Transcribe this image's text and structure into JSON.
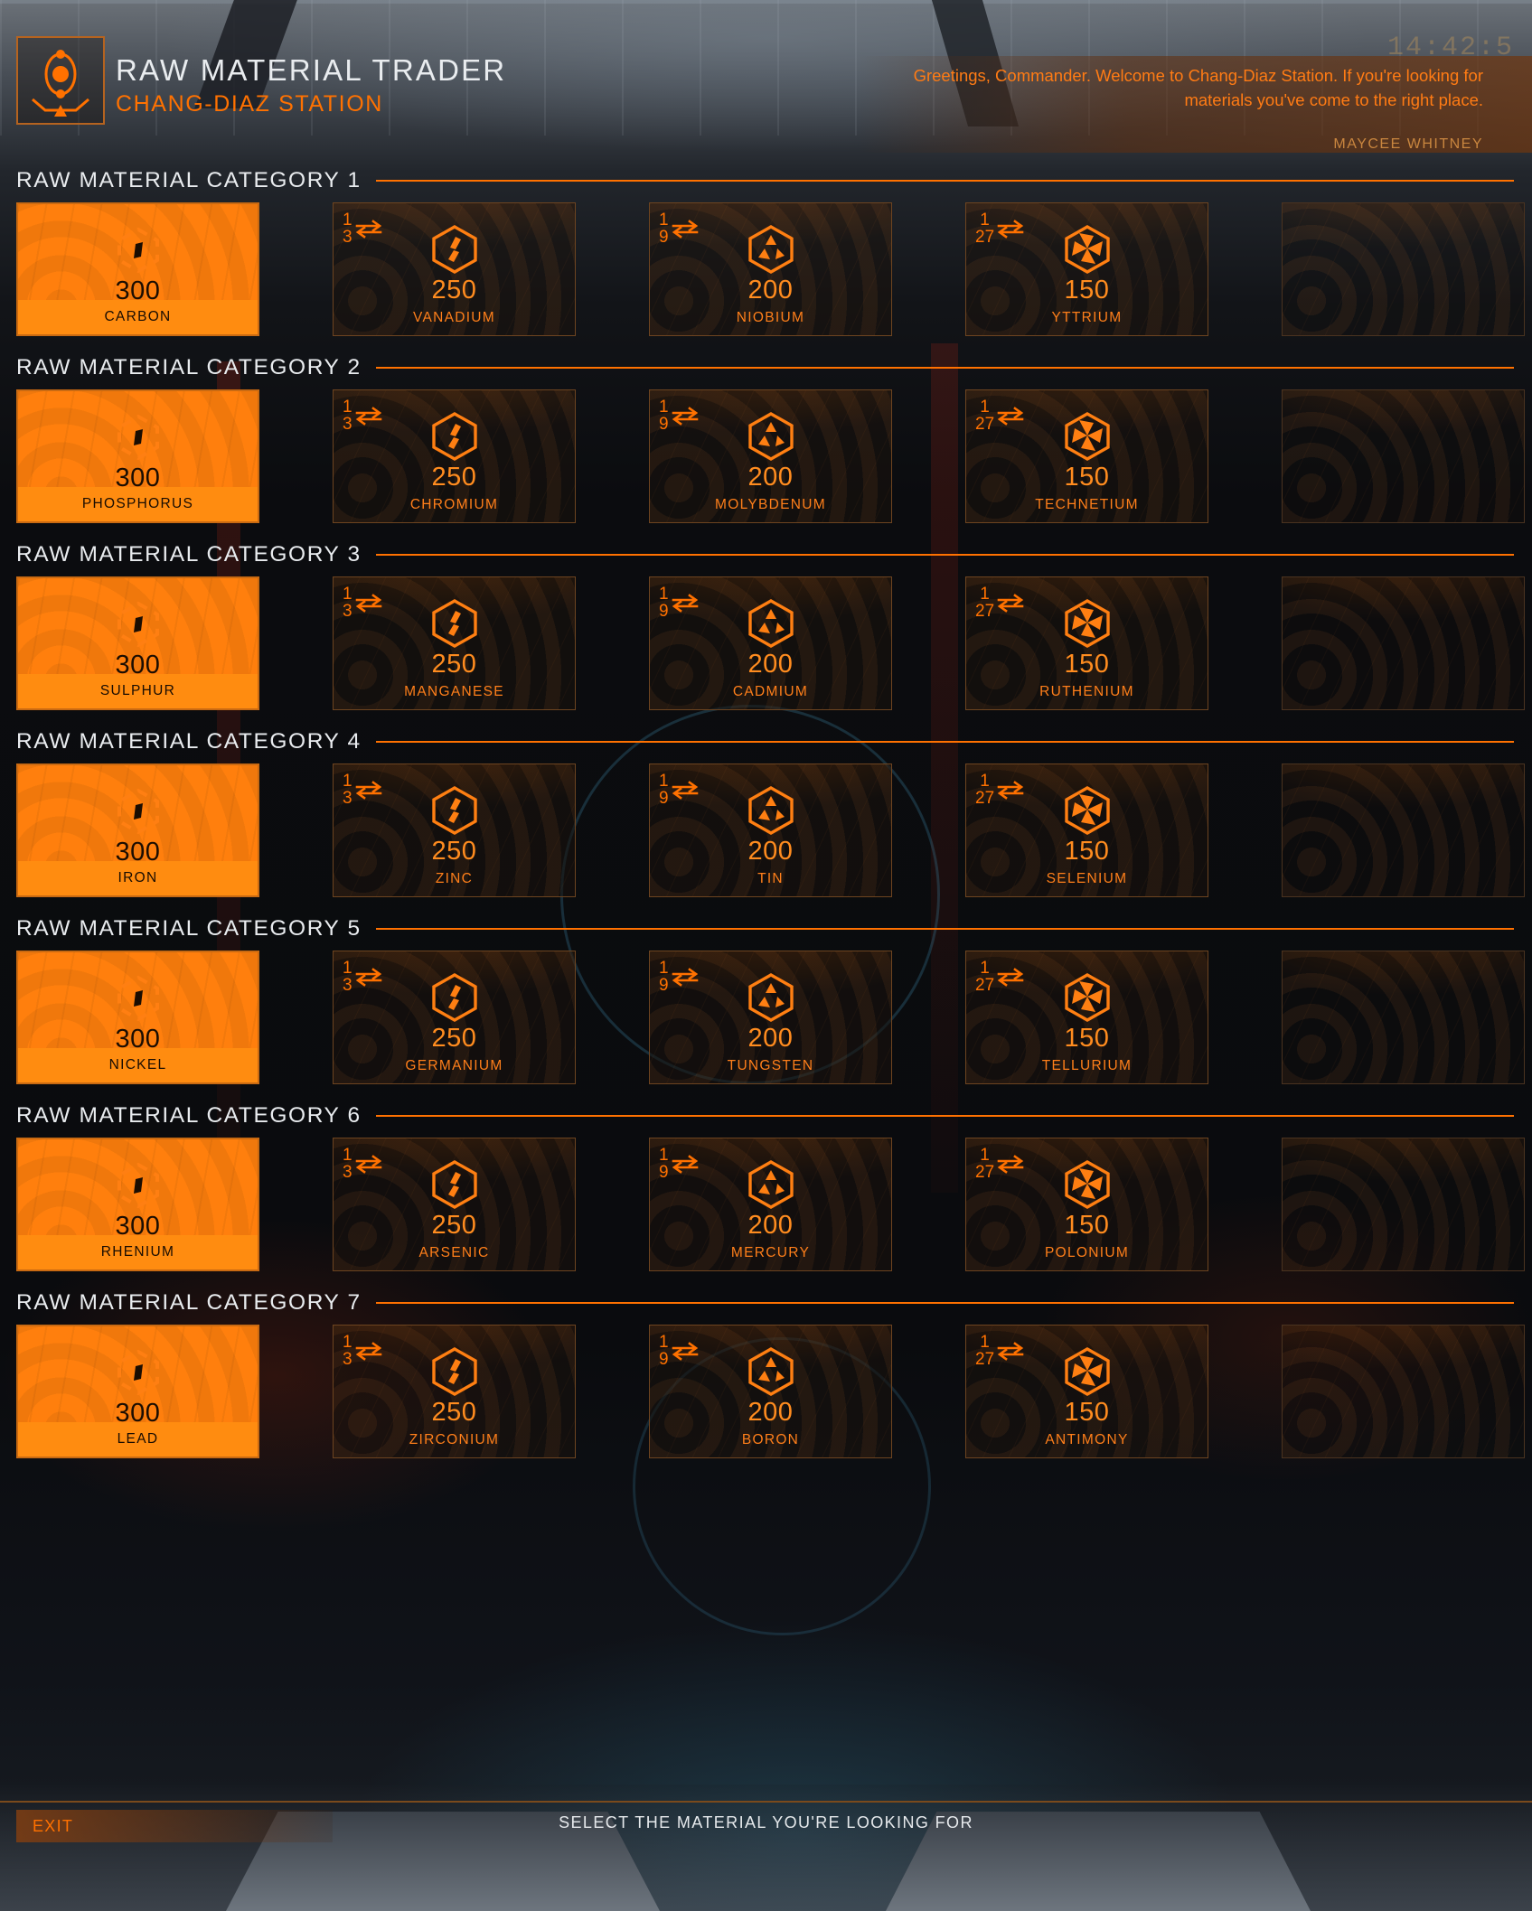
{
  "header": {
    "logo_icon": "trader-orbit-icon",
    "title": "RAW MATERIAL TRADER",
    "subtitle": "CHANG-DIAZ STATION",
    "greeting": "Greetings, Commander. Welcome to Chang-Diaz Station. If you're looking for materials you've come to the right place.",
    "greeting_author": "MAYCEE WHITNEY",
    "clock": "14:42:5"
  },
  "colors": {
    "accent": "#ff7100",
    "accent_bright": "#ff8c10",
    "title_text": "#e9ecef",
    "card_border": "#6d4420",
    "selected_text": "#180c02"
  },
  "ratios": {
    "grade1": null,
    "grade2": {
      "num": "1",
      "den": "3"
    },
    "grade3": {
      "num": "1",
      "den": "9"
    },
    "grade4": {
      "num": "1",
      "den": "27"
    }
  },
  "categories": [
    {
      "title": "RAW MATERIAL CATEGORY 1",
      "materials": [
        {
          "name": "CARBON",
          "value": "300",
          "icon": "grade1-diamond-icon",
          "grade": 1,
          "selected": true
        },
        {
          "name": "VANADIUM",
          "value": "250",
          "icon": "grade2-hex-icon",
          "grade": 2,
          "selected": false
        },
        {
          "name": "NIOBIUM",
          "value": "200",
          "icon": "grade3-hex-icon",
          "grade": 3,
          "selected": false
        },
        {
          "name": "YTTRIUM",
          "value": "150",
          "icon": "grade4-hex-icon",
          "grade": 4,
          "selected": false
        },
        {
          "name": "",
          "value": "",
          "icon": "",
          "grade": 0,
          "selected": false,
          "empty": true
        }
      ]
    },
    {
      "title": "RAW MATERIAL CATEGORY 2",
      "materials": [
        {
          "name": "PHOSPHORUS",
          "value": "300",
          "icon": "grade1-diamond-icon",
          "grade": 1,
          "selected": true
        },
        {
          "name": "CHROMIUM",
          "value": "250",
          "icon": "grade2-hex-icon",
          "grade": 2,
          "selected": false
        },
        {
          "name": "MOLYBDENUM",
          "value": "200",
          "icon": "grade3-hex-icon",
          "grade": 3,
          "selected": false
        },
        {
          "name": "TECHNETIUM",
          "value": "150",
          "icon": "grade4-hex-icon",
          "grade": 4,
          "selected": false
        },
        {
          "name": "",
          "value": "",
          "icon": "",
          "grade": 0,
          "selected": false,
          "empty": true
        }
      ]
    },
    {
      "title": "RAW MATERIAL CATEGORY 3",
      "materials": [
        {
          "name": "SULPHUR",
          "value": "300",
          "icon": "grade1-diamond-icon",
          "grade": 1,
          "selected": true
        },
        {
          "name": "MANGANESE",
          "value": "250",
          "icon": "grade2-hex-icon",
          "grade": 2,
          "selected": false
        },
        {
          "name": "CADMIUM",
          "value": "200",
          "icon": "grade3-hex-icon",
          "grade": 3,
          "selected": false
        },
        {
          "name": "RUTHENIUM",
          "value": "150",
          "icon": "grade4-hex-icon",
          "grade": 4,
          "selected": false
        },
        {
          "name": "",
          "value": "",
          "icon": "",
          "grade": 0,
          "selected": false,
          "empty": true
        }
      ]
    },
    {
      "title": "RAW MATERIAL CATEGORY 4",
      "materials": [
        {
          "name": "IRON",
          "value": "300",
          "icon": "grade1-diamond-icon",
          "grade": 1,
          "selected": true
        },
        {
          "name": "ZINC",
          "value": "250",
          "icon": "grade2-hex-icon",
          "grade": 2,
          "selected": false
        },
        {
          "name": "TIN",
          "value": "200",
          "icon": "grade3-hex-icon",
          "grade": 3,
          "selected": false
        },
        {
          "name": "SELENIUM",
          "value": "150",
          "icon": "grade4-hex-icon",
          "grade": 4,
          "selected": false
        },
        {
          "name": "",
          "value": "",
          "icon": "",
          "grade": 0,
          "selected": false,
          "empty": true
        }
      ]
    },
    {
      "title": "RAW MATERIAL CATEGORY 5",
      "materials": [
        {
          "name": "NICKEL",
          "value": "300",
          "icon": "grade1-diamond-icon",
          "grade": 1,
          "selected": true
        },
        {
          "name": "GERMANIUM",
          "value": "250",
          "icon": "grade2-hex-icon",
          "grade": 2,
          "selected": false
        },
        {
          "name": "TUNGSTEN",
          "value": "200",
          "icon": "grade3-hex-icon",
          "grade": 3,
          "selected": false
        },
        {
          "name": "TELLURIUM",
          "value": "150",
          "icon": "grade4-hex-icon",
          "grade": 4,
          "selected": false
        },
        {
          "name": "",
          "value": "",
          "icon": "",
          "grade": 0,
          "selected": false,
          "empty": true
        }
      ]
    },
    {
      "title": "RAW MATERIAL CATEGORY 6",
      "materials": [
        {
          "name": "RHENIUM",
          "value": "300",
          "icon": "grade1-diamond-icon",
          "grade": 1,
          "selected": true
        },
        {
          "name": "ARSENIC",
          "value": "250",
          "icon": "grade2-hex-icon",
          "grade": 2,
          "selected": false
        },
        {
          "name": "MERCURY",
          "value": "200",
          "icon": "grade3-hex-icon",
          "grade": 3,
          "selected": false
        },
        {
          "name": "POLONIUM",
          "value": "150",
          "icon": "grade4-hex-icon",
          "grade": 4,
          "selected": false
        },
        {
          "name": "",
          "value": "",
          "icon": "",
          "grade": 0,
          "selected": false,
          "empty": true
        }
      ]
    },
    {
      "title": "RAW MATERIAL CATEGORY 7",
      "materials": [
        {
          "name": "LEAD",
          "value": "300",
          "icon": "grade1-diamond-icon",
          "grade": 1,
          "selected": true
        },
        {
          "name": "ZIRCONIUM",
          "value": "250",
          "icon": "grade2-hex-icon",
          "grade": 2,
          "selected": false
        },
        {
          "name": "BORON",
          "value": "200",
          "icon": "grade3-hex-icon",
          "grade": 3,
          "selected": false
        },
        {
          "name": "ANTIMONY",
          "value": "150",
          "icon": "grade4-hex-icon",
          "grade": 4,
          "selected": false
        },
        {
          "name": "",
          "value": "",
          "icon": "",
          "grade": 0,
          "selected": false,
          "empty": true
        }
      ]
    }
  ],
  "footer": {
    "exit_label": "EXIT",
    "hint": "SELECT THE MATERIAL YOU'RE LOOKING FOR"
  }
}
